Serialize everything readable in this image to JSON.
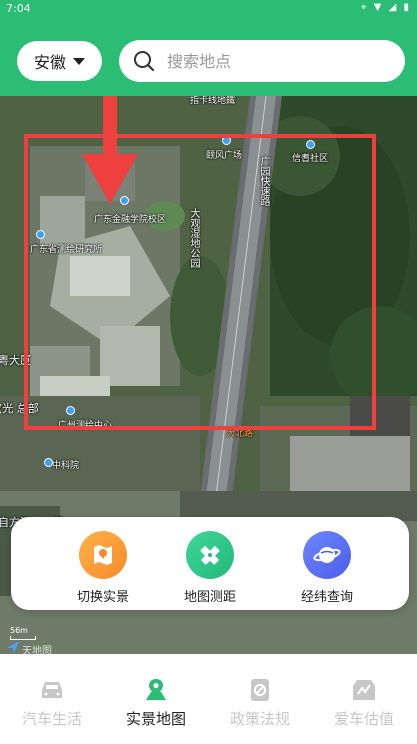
{
  "status_bar": {
    "time": "7:04",
    "icons": [
      "location-icon",
      "wifi-icon",
      "signal-icon",
      "battery-icon"
    ]
  },
  "header": {
    "region_label": "安徽",
    "search_placeholder": "搜索地点",
    "background_color": "#2bbd73"
  },
  "map": {
    "labels": {
      "top_road": "指卡线地鐵",
      "plaza": "颐风广场",
      "community": "信耆社区",
      "campus": "广东金融学院校区",
      "road_vertical_1": "广园快速路",
      "park": "大观湿地公园",
      "west_inst": "广东省测绘研究所",
      "west_building": "粤大厦",
      "west_hq": "(光 总部",
      "south_inst": "广州测绘中心",
      "south_poi": "中科院",
      "highway": "大北路",
      "bottom_left": "自方测绘地理",
      "scale": "56m",
      "logo": "天地图"
    },
    "highlight_color": "#ef4040"
  },
  "tools": [
    {
      "label": "切换实景",
      "icon": "map-pin-icon",
      "color": "#fba13a"
    },
    {
      "label": "地图测距",
      "icon": "ruler-icon",
      "color": "#2fc88a"
    },
    {
      "label": "经纬查询",
      "icon": "globe-icon",
      "color": "#5b6ff2"
    }
  ],
  "nav": [
    {
      "label": "汽车生活",
      "icon": "car-icon",
      "active": false
    },
    {
      "label": "实景地图",
      "icon": "map-pin-icon",
      "active": true
    },
    {
      "label": "政策法规",
      "icon": "policy-icon",
      "active": false
    },
    {
      "label": "爱车估值",
      "icon": "valuation-icon",
      "active": false
    }
  ],
  "colors": {
    "accent": "#2bbd73",
    "nav_inactive": "#c7c7c7",
    "nav_active_text": "#222222"
  }
}
